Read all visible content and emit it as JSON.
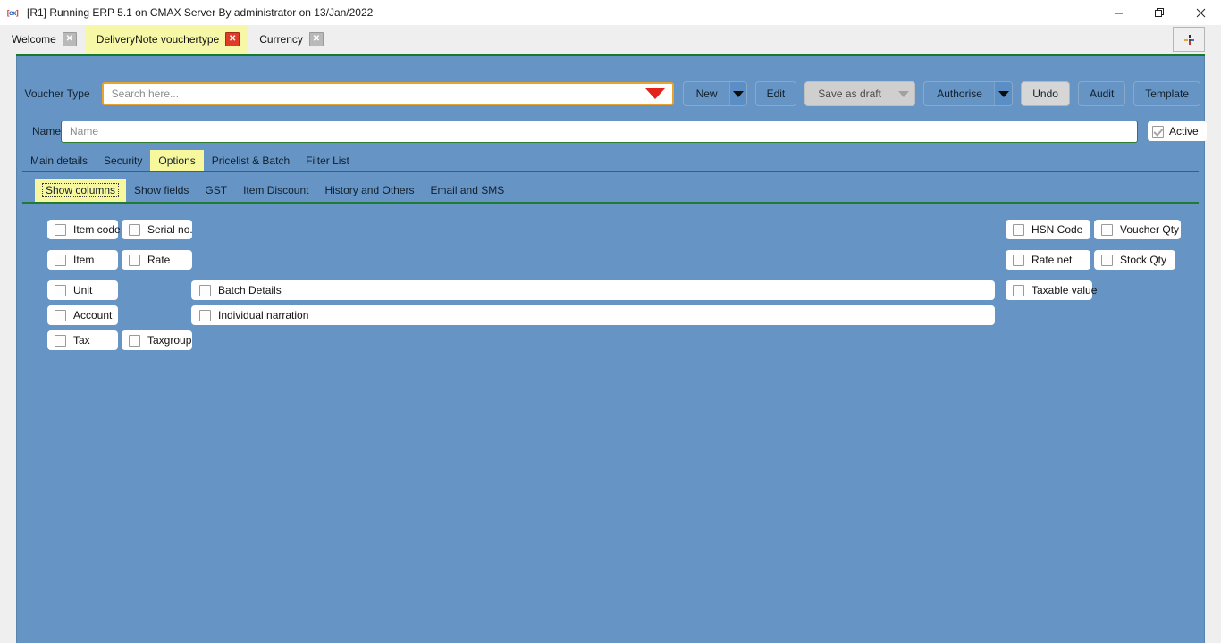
{
  "window": {
    "title": "[R1] Running ERP 5.1 on CMAX Server By administrator on 13/Jan/2022",
    "app_icon": "cx-app-icon",
    "minimize_label": "–",
    "maximize_label": "❐",
    "close_label": "✕"
  },
  "tabs": {
    "items": [
      {
        "label": "Welcome",
        "active": false,
        "close": "✕"
      },
      {
        "label": "DeliveryNote vouchertype",
        "active": true,
        "close": "✕"
      },
      {
        "label": "Currency",
        "active": false,
        "close": "✕"
      }
    ],
    "add_tab_icon": "plus-icon"
  },
  "form": {
    "voucher_type_label": "Voucher Type",
    "search": {
      "placeholder": "Search here...",
      "value": ""
    },
    "name_label": "Name",
    "name_field": {
      "placeholder": "Name",
      "value": ""
    },
    "active_checkbox": {
      "label": "Active",
      "checked": true
    }
  },
  "toolbar": {
    "new_label": "New",
    "edit_label": "Edit",
    "save_as_draft_label": "Save as draft",
    "authorise_label": "Authorise",
    "undo_label": "Undo",
    "audit_label": "Audit",
    "template_label": "Template"
  },
  "main_tabs": [
    {
      "label": "Main details",
      "active": false
    },
    {
      "label": "Security",
      "active": false
    },
    {
      "label": "Options",
      "active": true
    },
    {
      "label": "Pricelist & Batch",
      "active": false
    },
    {
      "label": "Filter List",
      "active": false
    }
  ],
  "sub_tabs": [
    {
      "label": "Show columns",
      "active": true
    },
    {
      "label": "Show fields",
      "active": false
    },
    {
      "label": "GST",
      "active": false
    },
    {
      "label": "Item Discount",
      "active": false
    },
    {
      "label": "History and Others",
      "active": false
    },
    {
      "label": "Email and SMS",
      "active": false
    }
  ],
  "options": {
    "left_column": [
      {
        "label": "Item code",
        "checked": false
      },
      {
        "label": "Item",
        "checked": false
      },
      {
        "label": "Unit",
        "checked": false
      },
      {
        "label": "Account",
        "checked": false
      },
      {
        "label": "Tax",
        "checked": false
      }
    ],
    "second_column": [
      {
        "label": "Serial no.",
        "checked": false
      },
      {
        "label": "Rate",
        "checked": false
      },
      {
        "label": "Taxgroup",
        "checked": false
      }
    ],
    "wide_fields": [
      {
        "label": "Batch Details",
        "checked": false
      },
      {
        "label": "Individual narration",
        "checked": false
      }
    ],
    "right_column_a": [
      {
        "label": "HSN  Code",
        "checked": false
      },
      {
        "label": "Rate net",
        "checked": false
      },
      {
        "label": "Taxable value",
        "checked": false
      }
    ],
    "right_column_b": [
      {
        "label": "Voucher Qty",
        "checked": false
      },
      {
        "label": "Stock Qty",
        "checked": false
      }
    ]
  },
  "colors": {
    "form_background": "#6694c4",
    "accent_green": "#1f7a33",
    "active_tab_yellow": "#f7f79e",
    "focus_orange": "#e8a32e",
    "dropdown_red": "#e32219"
  }
}
